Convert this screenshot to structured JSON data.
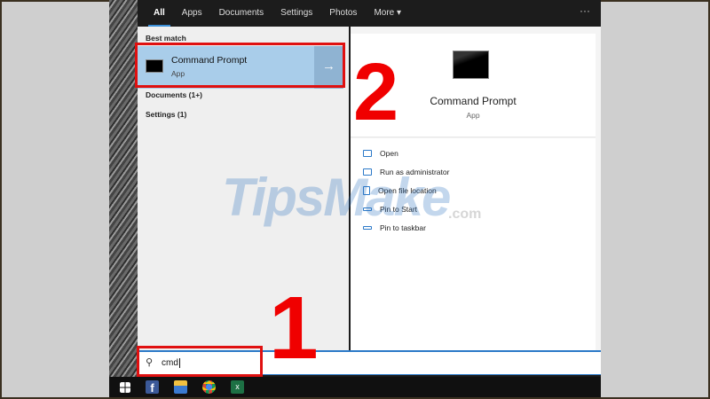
{
  "tabs": [
    "All",
    "Apps",
    "Documents",
    "Settings",
    "Photos",
    "More ▾"
  ],
  "more_options": "···",
  "left_panel": {
    "best_match_header": "Best match",
    "best_match": {
      "title": "Command Prompt",
      "subtitle": "App",
      "arrow": "→"
    },
    "documents": "Documents (1+)",
    "settings": "Settings (1)"
  },
  "right_panel": {
    "title": "Command Prompt",
    "subtitle": "App",
    "actions": [
      "Open",
      "Run as administrator",
      "Open file location",
      "Pin to Start",
      "Pin to taskbar"
    ]
  },
  "search": {
    "icon": "search-icon",
    "value": "cmd"
  },
  "taskbar": [
    "windows-start",
    "facebook",
    "file-explorer",
    "chrome",
    "excel"
  ],
  "annotations": {
    "step1": "1",
    "step2": "2"
  },
  "watermark": {
    "main": "TipsMake",
    "suffix": ".com"
  },
  "colors": {
    "accent": "#2b79c8",
    "highlight": "#a9cdea",
    "annotation": "#e01010"
  }
}
